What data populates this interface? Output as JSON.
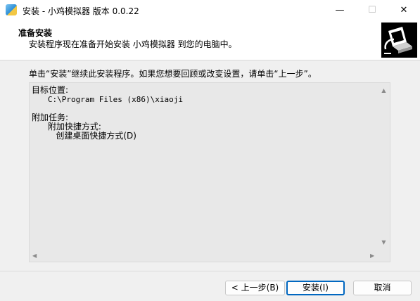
{
  "window": {
    "title": "安装 - 小鸡模拟器 版本 0.0.22",
    "minimize_glyph": "—",
    "maximize_glyph": "☐",
    "close_glyph": "✕"
  },
  "header": {
    "title": "准备安装",
    "subtitle": "安装程序现在准备开始安装 小鸡模拟器 到您的电脑中。",
    "logo_icon": "computer-install-icon"
  },
  "instruction": "单击“安装”继续此安装程序。如果您想要回顾或改变设置，请单击“上一步”。",
  "memo": {
    "dest_label": "目标位置:",
    "dest_value": "C:\\Program Files (x86)\\xiaoji",
    "tasks_label": "附加任务:",
    "task_group": "附加快捷方式:",
    "task_item": "创建桌面快捷方式(D)",
    "scroll_up": "▲",
    "scroll_down": "▼",
    "scroll_left": "◀",
    "scroll_right": "▶"
  },
  "buttons": {
    "back": "< 上一步(B)",
    "install": "安装(I)",
    "cancel": "取消"
  }
}
